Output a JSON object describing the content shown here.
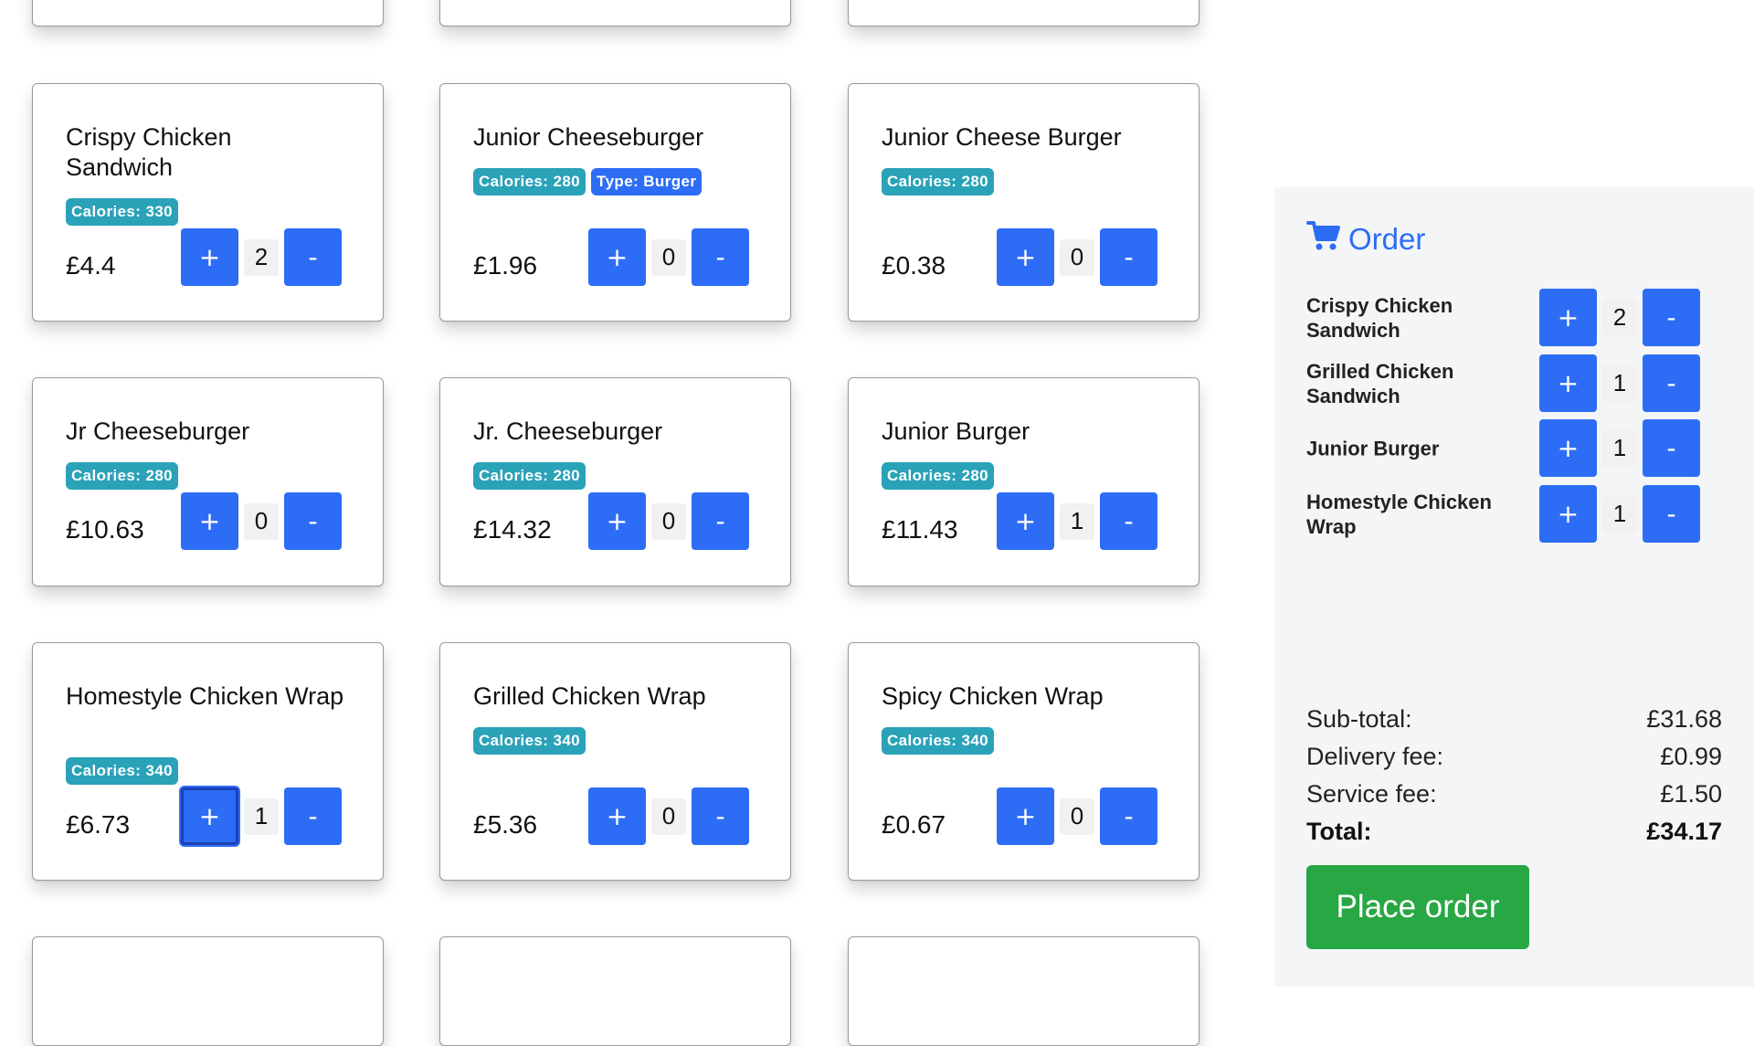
{
  "menu": {
    "row2": [
      {
        "name": "Crispy Chicken Sandwich",
        "badges": [
          "Calories: 330"
        ],
        "price": "£4.4",
        "qty": "2"
      },
      {
        "name": "Junior Cheeseburger",
        "badges": [
          "Calories: 280",
          "Type: Burger"
        ],
        "price": "£1.96",
        "qty": "0"
      },
      {
        "name": "Junior Cheese Burger",
        "badges": [
          "Calories: 280"
        ],
        "price": "£0.38",
        "qty": "0"
      }
    ],
    "row3": [
      {
        "name": "Jr Cheeseburger",
        "badges": [
          "Calories: 280"
        ],
        "price": "£10.63",
        "qty": "0"
      },
      {
        "name": "Jr. Cheeseburger",
        "badges": [
          "Calories: 280"
        ],
        "price": "£14.32",
        "qty": "0"
      },
      {
        "name": "Junior Burger",
        "badges": [
          "Calories: 280"
        ],
        "price": "£11.43",
        "qty": "1"
      }
    ],
    "row4": [
      {
        "name": "Homestyle Chicken Wrap",
        "badges": [
          "Calories: 340"
        ],
        "price": "£6.73",
        "qty": "1"
      },
      {
        "name": "Grilled Chicken Wrap",
        "badges": [
          "Calories: 340"
        ],
        "price": "£5.36",
        "qty": "0"
      },
      {
        "name": "Spicy Chicken Wrap",
        "badges": [
          "Calories: 340"
        ],
        "price": "£0.67",
        "qty": "0"
      }
    ],
    "plus_label": "+",
    "minus_label": "-"
  },
  "order": {
    "title": "Order",
    "icon": "cart-icon",
    "items": [
      {
        "name": "Crispy Chicken Sandwich",
        "qty": "2"
      },
      {
        "name": "Grilled Chicken Sandwich",
        "qty": "1"
      },
      {
        "name": "Junior Burger",
        "qty": "1"
      },
      {
        "name": "Homestyle Chicken Wrap",
        "qty": "1"
      }
    ],
    "subtotal_label": "Sub-total:",
    "subtotal": "£31.68",
    "delivery_label": "Delivery fee:",
    "delivery": "£0.99",
    "service_label": "Service fee:",
    "service": "£1.50",
    "total_label": "Total:",
    "total": "£34.17",
    "place_order_label": "Place order"
  },
  "colors": {
    "primary": "#2d6df6",
    "calories_badge": "#2aa2b8",
    "place_order": "#28a745",
    "panel_bg": "#f4f5f7"
  }
}
